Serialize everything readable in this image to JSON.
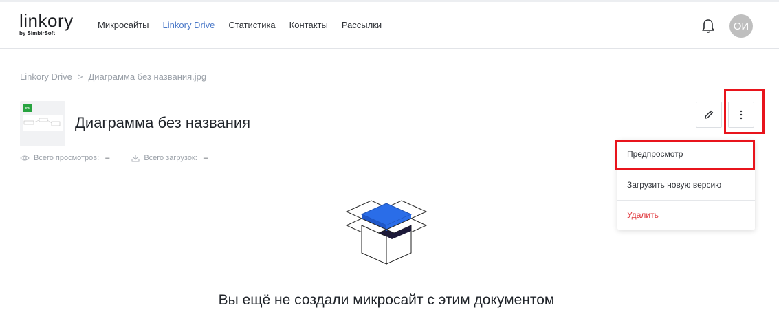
{
  "header": {
    "logo": {
      "name": "linkory",
      "sub": "by SimbirSoft"
    },
    "nav": [
      {
        "label": "Микросайты",
        "active": false
      },
      {
        "label": "Linkory Drive",
        "active": true
      },
      {
        "label": "Статистика",
        "active": false
      },
      {
        "label": "Контакты",
        "active": false
      },
      {
        "label": "Рассылки",
        "active": false
      }
    ],
    "bell_icon": "bell-icon",
    "avatar_initials": "ОИ"
  },
  "breadcrumb": {
    "root": "Linkory Drive",
    "separator": ">",
    "current": "Диаграмма без названия.jpg"
  },
  "file": {
    "badge": "JPG",
    "title": "Диаграмма без названия",
    "views_label": "Всего просмотров:",
    "views_value": "–",
    "downloads_label": "Всего загрузок:",
    "downloads_value": "–"
  },
  "actions": {
    "edit_icon": "pencil-icon",
    "more_icon": "more-vertical-icon"
  },
  "menu": {
    "preview": "Предпросмотр",
    "upload_new": "Загрузить новую версию",
    "delete": "Удалить"
  },
  "empty_state": {
    "message": "Вы ещё не создали микросайт с этим документом"
  },
  "colors": {
    "accent": "#4a78c8",
    "danger": "#e0393e",
    "highlight": "#e8141c",
    "box_blue": "#2a6de8"
  }
}
